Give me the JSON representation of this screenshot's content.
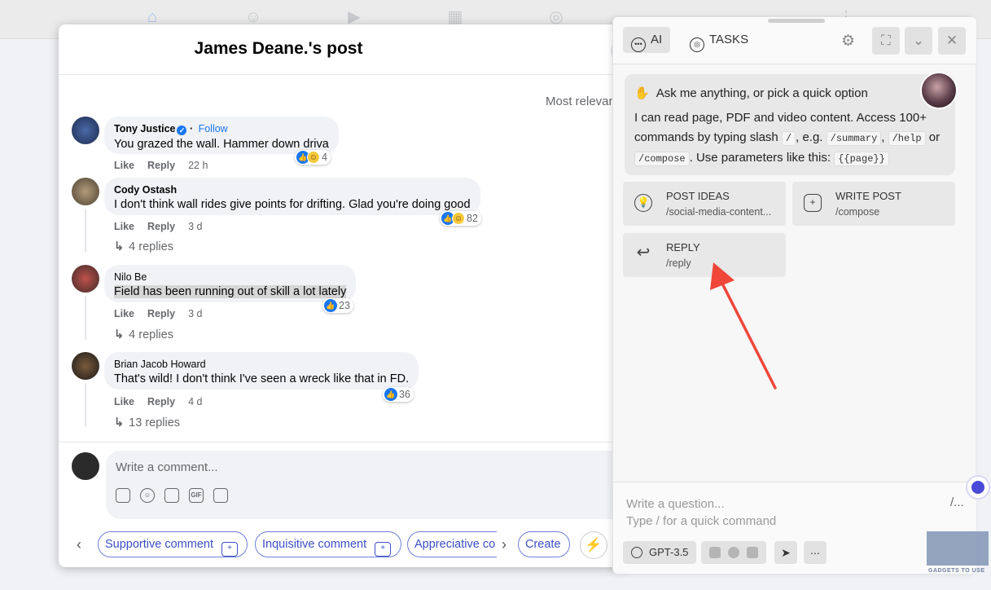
{
  "post": {
    "title": "James Deane.'s post",
    "sort_label": "Most relevant"
  },
  "comments": [
    {
      "name": "Tony Justice",
      "follow": "Follow",
      "text": "You grazed the wall. Hammer down driva",
      "reactions": "4",
      "like": "Like",
      "reply": "Reply",
      "time": "22 h"
    },
    {
      "name": "Cody Ostash",
      "text": "I don't think wall rides give points for drifting. Glad you're doing good",
      "reactions": "82",
      "like": "Like",
      "reply": "Reply",
      "time": "3 d",
      "replies": "4 replies"
    },
    {
      "name": "Nilo Be",
      "text": "Field has been running out of skill a lot lately",
      "reactions": "23",
      "like": "Like",
      "reply": "Reply",
      "time": "3 d",
      "replies": "4 replies"
    },
    {
      "name": "Brian Jacob Howard",
      "text": "That's wild! I don't think I've seen a wreck like that in FD.",
      "reactions": "36",
      "like": "Like",
      "reply": "Reply",
      "time": "4 d",
      "replies": "13 replies"
    }
  ],
  "composer": {
    "placeholder": "Write a comment..."
  },
  "quick_bar": {
    "pills": [
      "Supportive comment",
      "Inquisitive comment",
      "Appreciative co",
      "Create"
    ]
  },
  "ai_panel": {
    "tabs": {
      "ai": "AI",
      "tasks": "TASKS"
    },
    "greeting": "Ask me anything, or pick a quick option",
    "intro_1": "I can read page, PDF and video content. Access 100+ commands by typing slash",
    "slash_code": "/",
    "intro_2": ", e.g.",
    "cmd_summary": "/summary",
    "cmd_help": "/help",
    "intro_3": "or",
    "cmd_compose": "/compose",
    "intro_4": ". Use parameters like this:",
    "param_page": "{{page}}",
    "options": [
      {
        "title": "POST IDEAS",
        "cmd": "/social-media-content..."
      },
      {
        "title": "WRITE POST",
        "cmd": "/compose"
      },
      {
        "title": "REPLY",
        "cmd": "/reply"
      }
    ],
    "input_placeholder_1": "Write a question...",
    "input_placeholder_2": "Type / for a quick command",
    "input_slash": "/...",
    "model": "GPT-3.5",
    "more": "..."
  },
  "watermark": "GADGETS TO USE",
  "colors": {
    "annotation_arrow": "#f0463a",
    "facebook_blue": "#1877f2",
    "pill_blue": "#3d4fc4"
  }
}
